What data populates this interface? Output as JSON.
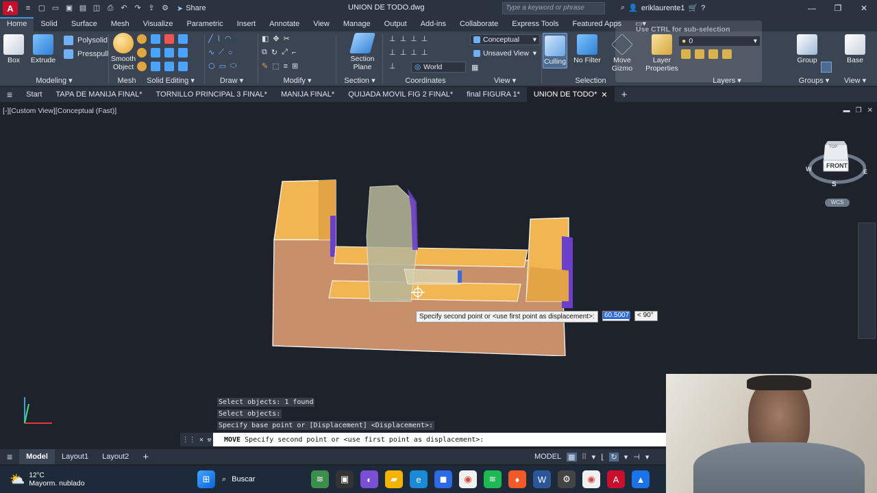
{
  "app": {
    "title": "UNION DE TODO.dwg",
    "logo": "A",
    "share": "Share",
    "search_placeholder": "Type a keyword or phrase",
    "user": "eriklaurente1"
  },
  "ribbon_tabs": [
    "Home",
    "Solid",
    "Surface",
    "Mesh",
    "Visualize",
    "Parametric",
    "Insert",
    "Annotate",
    "View",
    "Manage",
    "Output",
    "Add-ins",
    "Collaborate",
    "Express Tools",
    "Featured Apps"
  ],
  "ribbon": {
    "box": "Box",
    "extrude": "Extrude",
    "polysolid": "Polysolid",
    "presspull": "Presspull",
    "smooth": "Smooth Object",
    "section_plane": "Section Plane",
    "culling": "Culling",
    "no_filter": "No Filter",
    "move_gizmo": "Move Gizmo",
    "layer_props": "Layer Properties",
    "group": "Group",
    "base": "Base",
    "visual_style": "Conceptual",
    "view_state": "Unsaved View",
    "ucs": "World",
    "layer_value": "0",
    "panels": {
      "modeling": "Modeling",
      "mesh": "Mesh",
      "solid_editing": "Solid Editing",
      "draw": "Draw",
      "modify": "Modify",
      "section": "Section",
      "coordinates": "Coordinates",
      "view": "View",
      "selection": "Selection",
      "layers": "Layers",
      "groups": "Groups",
      "view2": "View"
    },
    "ghost_tip": "Use CTRL for sub-selection"
  },
  "file_tabs": [
    "Start",
    "TAPA DE MANIJA FINAL*",
    "TORNILLO PRINCIPAL 3 FINAL*",
    "MANIJA FINAL*",
    "QUIJADA MOVIL FIG 2 FINAL*",
    "final FIGURA 1*",
    "UNION DE TODO*"
  ],
  "viewport": {
    "label": "[-][Custom View][Conceptual (Fast)]",
    "cube_front": "FRONT",
    "cube_top": "TOP",
    "cube_w": "W",
    "cube_e": "E",
    "cube_s": "S",
    "wcs": "WCS",
    "tooltip": "Specify second point or <use first point as displacement>:",
    "input_value": "60.5007",
    "angle": "< 90°"
  },
  "command": {
    "history": [
      "Select objects: 1 found",
      "Select objects:",
      "Specify base point or [Displacement] <Displacement>:"
    ],
    "current_cmd": "MOVE",
    "current_prompt": "Specify second point or <use first point as displacement>:"
  },
  "layout_tabs": [
    "Model",
    "Layout1",
    "Layout2"
  ],
  "status": {
    "model": "MODEL"
  },
  "taskbar": {
    "temp": "12°C",
    "weather": "Mayorm. nublado",
    "search": "Buscar"
  },
  "colors": {
    "accent": "#4a90d9",
    "solid_top": "#f1b552",
    "solid_side": "#c7906b",
    "violet": "#6a3fc9",
    "bg": "#1e232b"
  }
}
